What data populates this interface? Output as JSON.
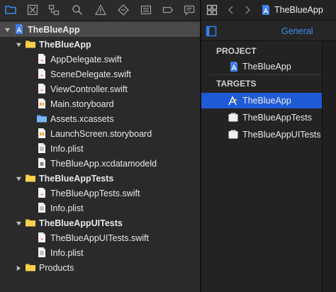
{
  "navigator": {
    "toolbar_icons": [
      "folder-icon",
      "source-control-icon",
      "symbol-hierarchy-icon",
      "find-icon",
      "issue-warning-icon",
      "test-diamond-icon",
      "debug-list-icon",
      "breakpoint-icon",
      "report-bubble-icon"
    ],
    "tree": [
      {
        "label": "TheBlueApp",
        "icon": "blue-project-icon",
        "expanded": true,
        "bold": true
      },
      {
        "label": "TheBlueApp",
        "icon": "yellow-folder-icon",
        "expanded": true,
        "bold": true
      },
      {
        "label": "AppDelegate.swift",
        "icon": "swift-file-icon"
      },
      {
        "label": "SceneDelegate.swift",
        "icon": "swift-file-icon"
      },
      {
        "label": "ViewController.swift",
        "icon": "swift-file-icon"
      },
      {
        "label": "Main.storyboard",
        "icon": "storyboard-file-icon"
      },
      {
        "label": "Assets.xcassets",
        "icon": "assets-folder-icon"
      },
      {
        "label": "LaunchScreen.storyboard",
        "icon": "storyboard-file-icon"
      },
      {
        "label": "Info.plist",
        "icon": "plist-file-icon"
      },
      {
        "label": "TheBlueApp.xcdatamodeld",
        "icon": "datamodel-file-icon"
      },
      {
        "label": "TheBlueAppTests",
        "icon": "yellow-folder-icon",
        "expanded": true,
        "bold": true
      },
      {
        "label": "TheBlueAppTests.swift",
        "icon": "swift-file-icon"
      },
      {
        "label": "Info.plist",
        "icon": "plist-file-icon"
      },
      {
        "label": "TheBlueAppUITests",
        "icon": "yellow-folder-icon",
        "expanded": true,
        "bold": true
      },
      {
        "label": "TheBlueAppUITests.swift",
        "icon": "swift-file-icon"
      },
      {
        "label": "Info.plist",
        "icon": "plist-file-icon"
      },
      {
        "label": "Products",
        "icon": "yellow-folder-icon",
        "expanded": false,
        "bold": false
      }
    ],
    "selected_index": 0
  },
  "editor": {
    "breadcrumb_file": "TheBlueApp",
    "tab_general": "General",
    "project_header": "PROJECT",
    "project_item": "TheBlueApp",
    "targets_header": "TARGETS",
    "targets": [
      {
        "label": "TheBlueApp",
        "icon": "app-target-icon",
        "selected": true
      },
      {
        "label": "TheBlueAppTests",
        "icon": "test-bundle-icon",
        "selected": false
      },
      {
        "label": "TheBlueAppUITests",
        "icon": "test-bundle-icon",
        "selected": false
      }
    ]
  },
  "colors": {
    "selection_blue": "#1f5bd6",
    "folder_yellow": "#f4c430",
    "swift_orange": "#f05138",
    "accent_blue": "#2f80ed"
  }
}
